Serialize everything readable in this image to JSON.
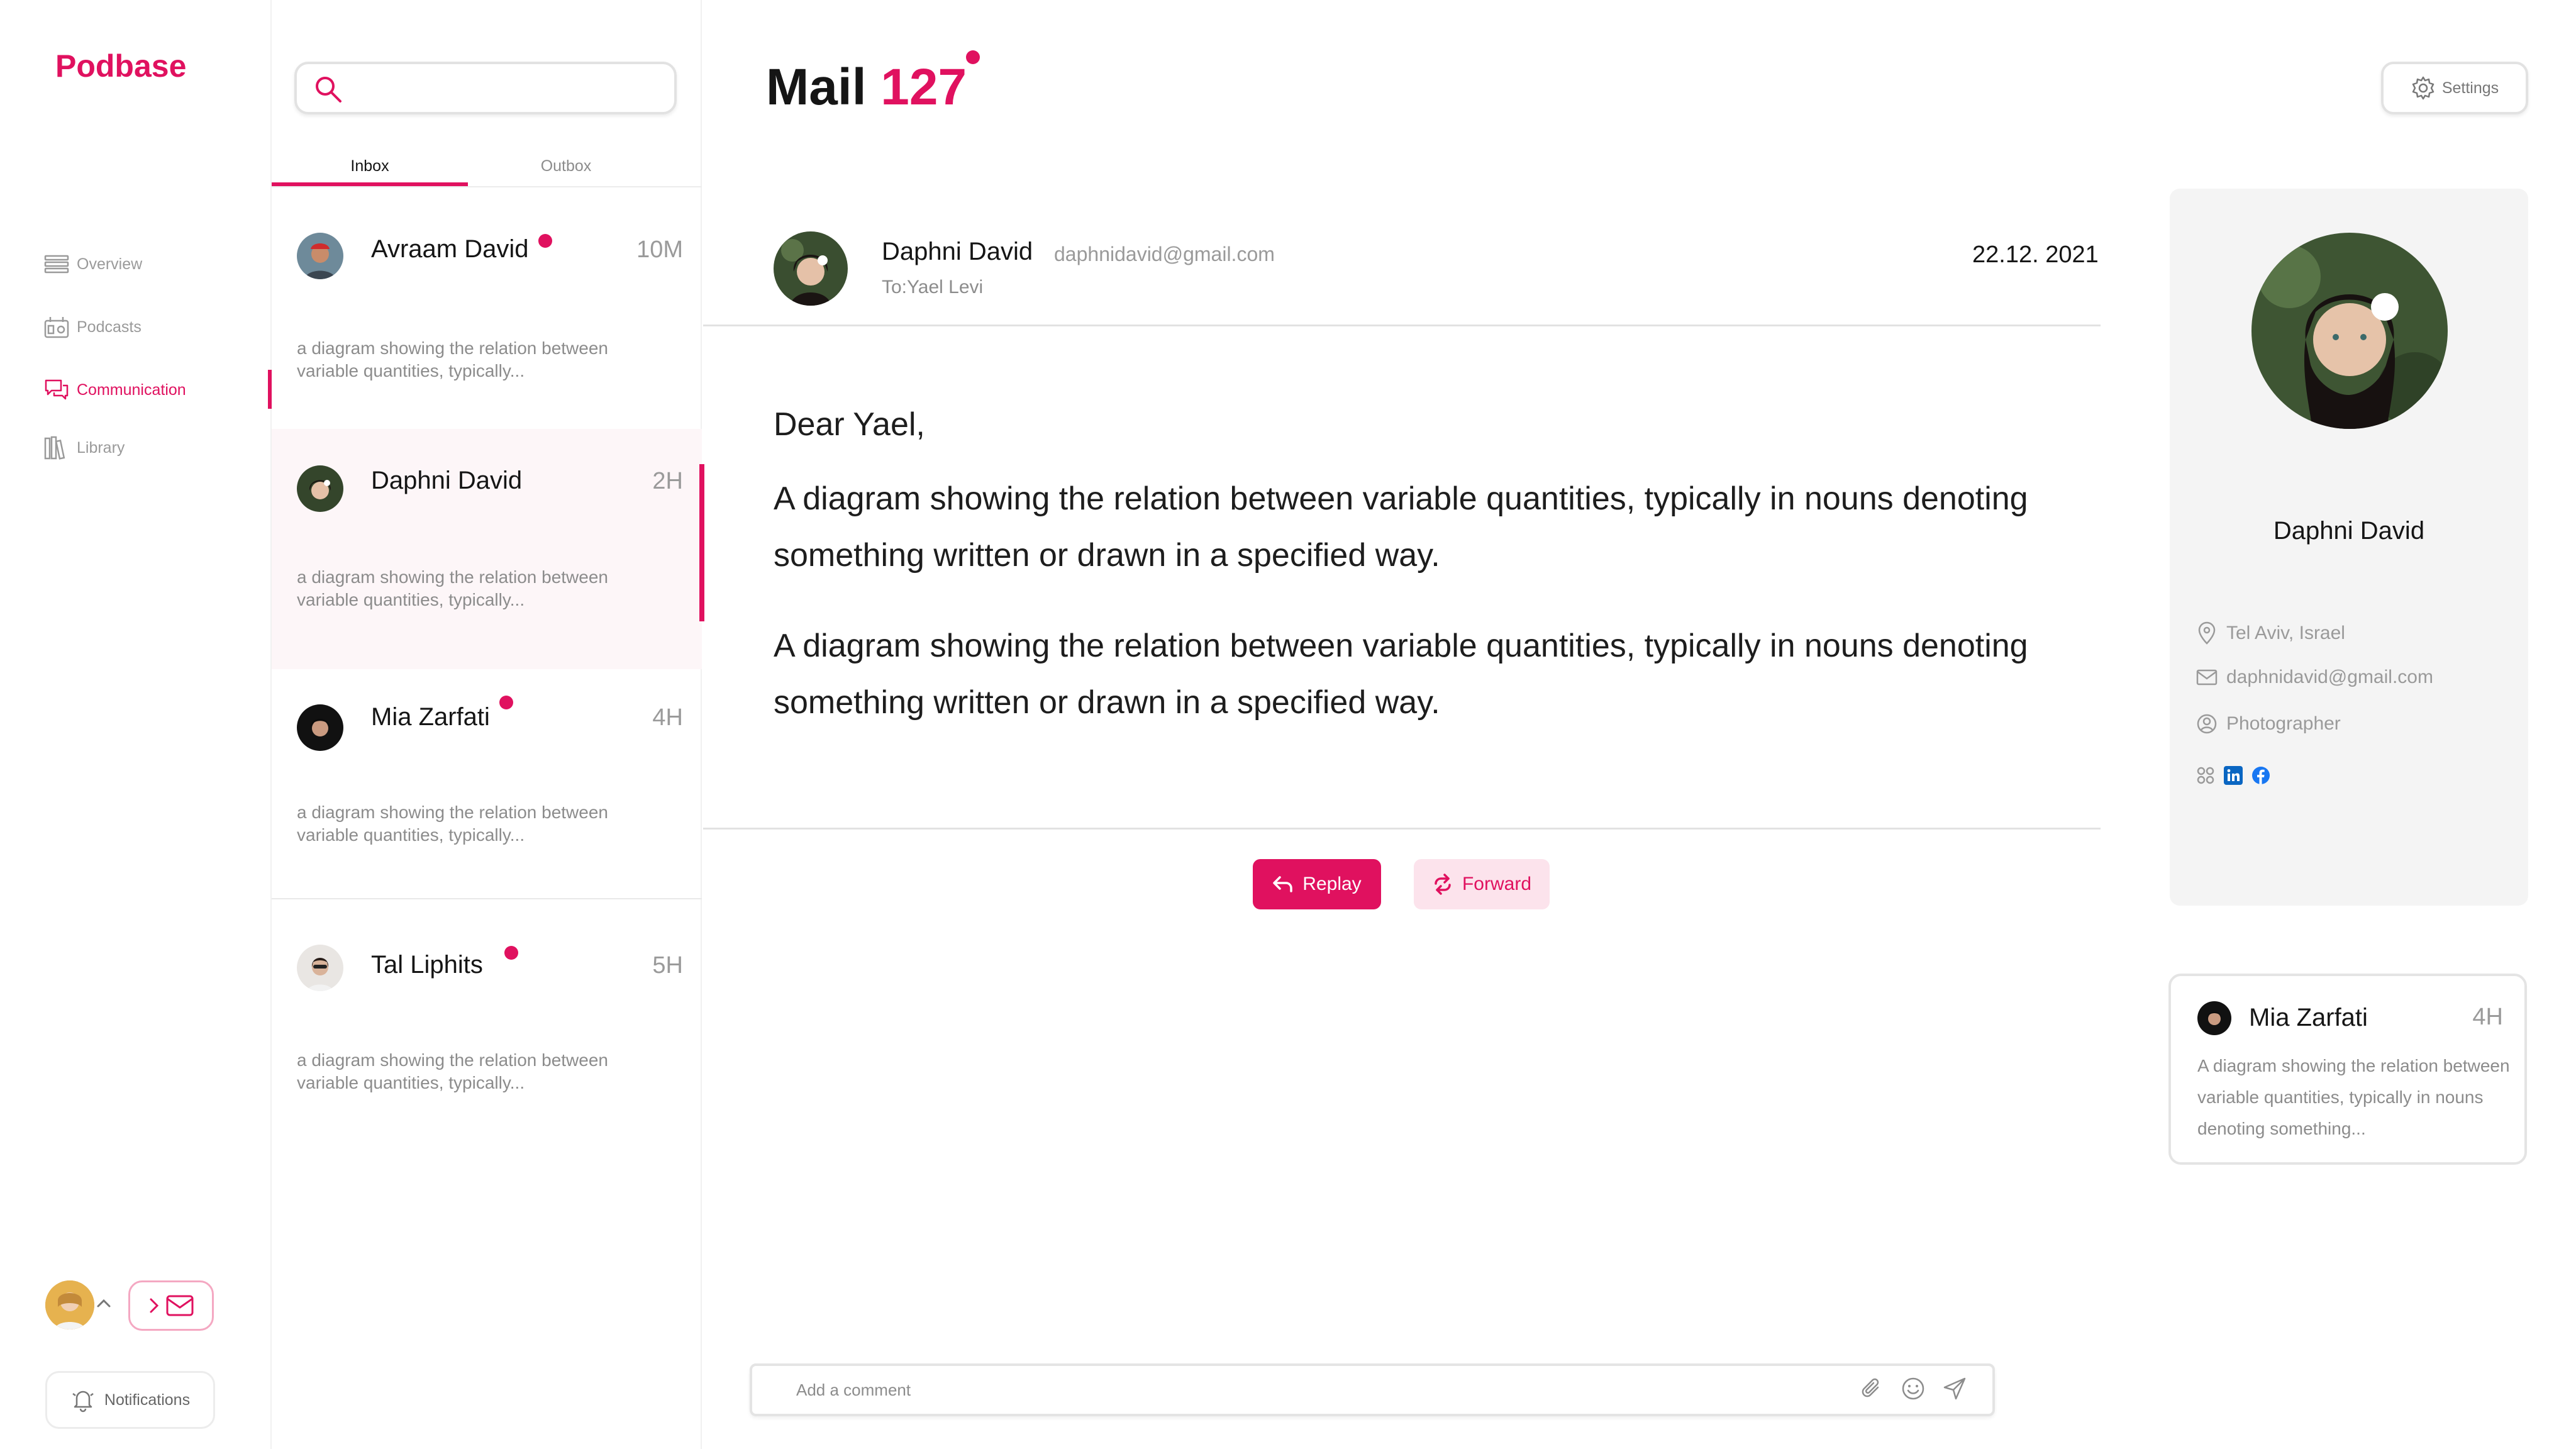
{
  "app": {
    "name": "Podbase"
  },
  "nav": [
    {
      "label": "Overview",
      "icon": "list-icon",
      "active": false
    },
    {
      "label": "Podcasts",
      "icon": "podcast-icon",
      "active": false
    },
    {
      "label": "Communication",
      "icon": "chat-icon",
      "active": true
    },
    {
      "label": "Library",
      "icon": "library-icon",
      "active": false
    }
  ],
  "sidebar": {
    "notifications_label": "Notifications"
  },
  "search": {
    "placeholder": "",
    "value": ""
  },
  "tabs": [
    {
      "label": "Inbox",
      "active": true
    },
    {
      "label": "Outbox",
      "active": false
    }
  ],
  "messages": [
    {
      "name": "Avraam David",
      "time": "10M",
      "unread": true,
      "preview": "a diagram showing the relation between variable quantities, typically..."
    },
    {
      "name": "Daphni David",
      "time": "2H",
      "unread": false,
      "selected": true,
      "preview": "a diagram showing the relation between variable quantities, typically..."
    },
    {
      "name": "Mia Zarfati",
      "time": "4H",
      "unread": true,
      "preview": "a diagram showing the relation between variable quantities, typically..."
    },
    {
      "name": "Tal Liphits",
      "time": "5H",
      "unread": true,
      "preview": "a diagram showing the relation between variable quantities, typically..."
    }
  ],
  "header": {
    "title": "Mail",
    "count": "127",
    "settings_label": "Settings"
  },
  "email": {
    "sender_name": "Daphni David",
    "sender_email": "daphnidavid@gmail.com",
    "to": "To:Yael Levi",
    "date": "22.12. 2021",
    "greeting": "Dear Yael,",
    "paragraphs": [
      "A diagram showing the relation between variable quantities, typically in nouns denoting something written or drawn in a specified way.",
      "A diagram showing the relation between variable quantities, typically in nouns denoting something written or drawn in a specified way."
    ],
    "reply_label": "Replay",
    "forward_label": "Forward"
  },
  "comment": {
    "placeholder": "Add a comment",
    "value": ""
  },
  "profile": {
    "name": "Daphni David",
    "location": "Tel Aviv, Israel",
    "email": "daphnidavid@gmail.com",
    "occupation": "Photographer",
    "socials": [
      "linkedin-icon",
      "facebook-icon"
    ]
  },
  "preview_card": {
    "name": "Mia Zarfati",
    "time": "4H",
    "text": "A diagram showing the relation between variable quantities, typically in nouns denoting something..."
  },
  "colors": {
    "accent": "#E0115F",
    "accent_light": "#fce3ec",
    "panel_bg": "#f4f4f4",
    "linkedin": "#0A66C2",
    "facebook": "#1877F2"
  }
}
